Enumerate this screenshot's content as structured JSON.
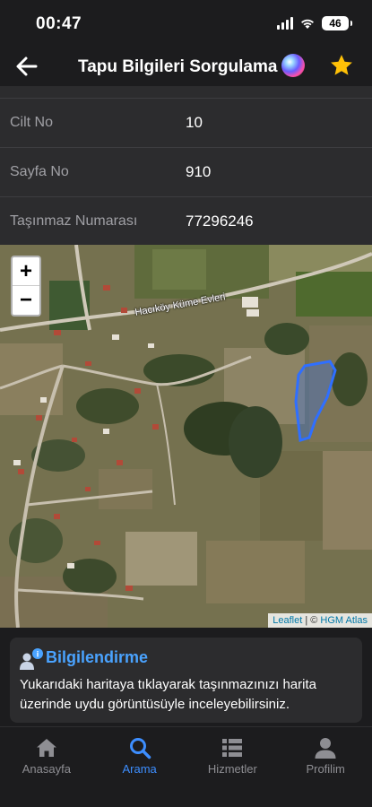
{
  "status_bar": {
    "time": "00:47",
    "battery": "46"
  },
  "nav": {
    "title": "Tapu Bilgileri Sorgulama"
  },
  "info_rows": [
    {
      "label": "Cilt No",
      "value": "10"
    },
    {
      "label": "Sayfa No",
      "value": "910"
    },
    {
      "label": "Taşınmaz Numarası",
      "value": "77296246"
    }
  ],
  "map": {
    "zoom_in": "+",
    "zoom_out": "−",
    "road_label": "Hacıköy Küme Evleri",
    "attribution_leaflet": "Leaflet",
    "attribution_sep": " | © ",
    "attribution_source": "HGM Atlas",
    "parcel_color": "#2f6fff"
  },
  "info_card": {
    "title": "Bilgilendirme",
    "text": "Yukarıdaki haritaya tıklayarak taşınmazınızı harita üzerinde uydu görüntüsüyle inceleyebilirsiniz."
  },
  "tabs": [
    {
      "label": "Anasayfa",
      "icon": "home-icon"
    },
    {
      "label": "Arama",
      "icon": "search-icon"
    },
    {
      "label": "Hizmetler",
      "icon": "list-icon"
    },
    {
      "label": "Profilim",
      "icon": "person-icon"
    }
  ],
  "colors": {
    "accent": "#3d8eff",
    "title_accent": "#4aa3ff",
    "star": "#ffc107"
  }
}
